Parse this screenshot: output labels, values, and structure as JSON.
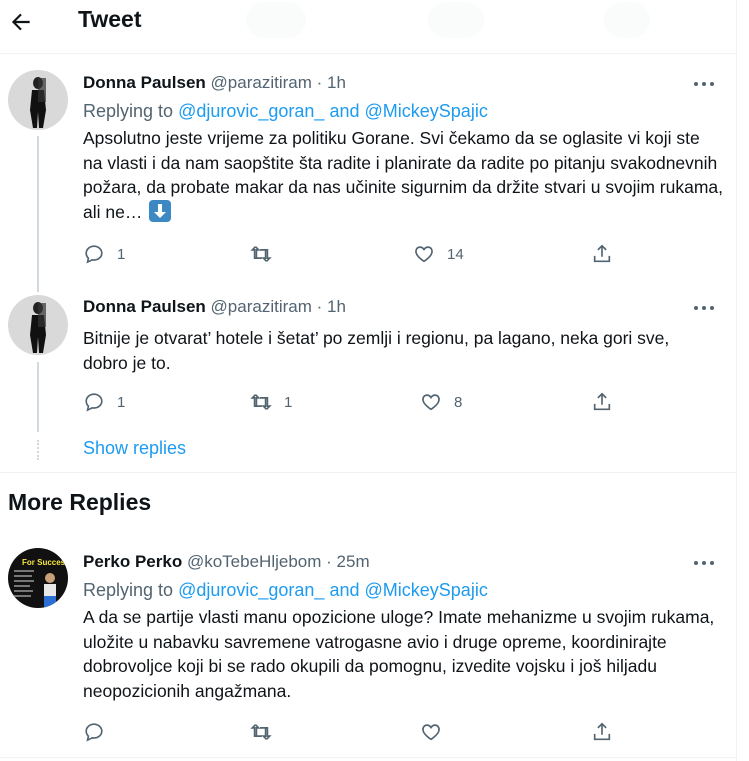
{
  "header": {
    "title": "Tweet"
  },
  "replies": [
    {
      "name": "Donna Paulsen",
      "handle": "@parazitiram",
      "dot": "·",
      "time": "1h",
      "replying_label": "Replying to",
      "mention1": "@djurovic_goran_",
      "and": "and",
      "mention2": "@MickeySpajic",
      "text": "Apsolutno jeste vrijeme za politiku Gorane. Svi čekamo da se oglasite vi koji ste na vlasti i da nam saopštite šta radite i planirate da radite po pitanju svakodnevnih požara, da probate makar da nas učinite sigurnim da držite stvari u svojim rukama, ali ne…",
      "reply_count": "1",
      "retweet_count": "",
      "like_count": "14"
    },
    {
      "name": "Donna Paulsen",
      "handle": "@parazitiram",
      "dot": "·",
      "time": "1h",
      "text": "Bitnije je otvarat’ hotele i šetat’ po zemlji i regionu, pa lagano, neka gori sve, dobro je to.",
      "reply_count": "1",
      "retweet_count": "1",
      "like_count": "8"
    }
  ],
  "show_replies": "Show replies",
  "more_replies_heading": "More Replies",
  "more_reply": {
    "name": "Perko Perko",
    "handle": "@koTebeHljebom",
    "dot": "·",
    "time": "25m",
    "replying_label": "Replying to",
    "mention1": "@djurovic_goran_",
    "and": "and",
    "mention2": "@MickeySpajic",
    "text": "A da se partije vlasti manu opozicione uloge? Imate mehanizme u svojim rukama, uložite u nabavku savremene vatrogasne avio i druge opreme, koordinirajte dobrovoljce koji bi se rado okupili da pomognu, izvedite vojsku i još hiljadu neopozicionih angažmana.",
    "avatar_text": "For Success"
  },
  "colors": {
    "accent": "#1d9bf0",
    "muted": "#536471",
    "text": "#0f1419"
  }
}
